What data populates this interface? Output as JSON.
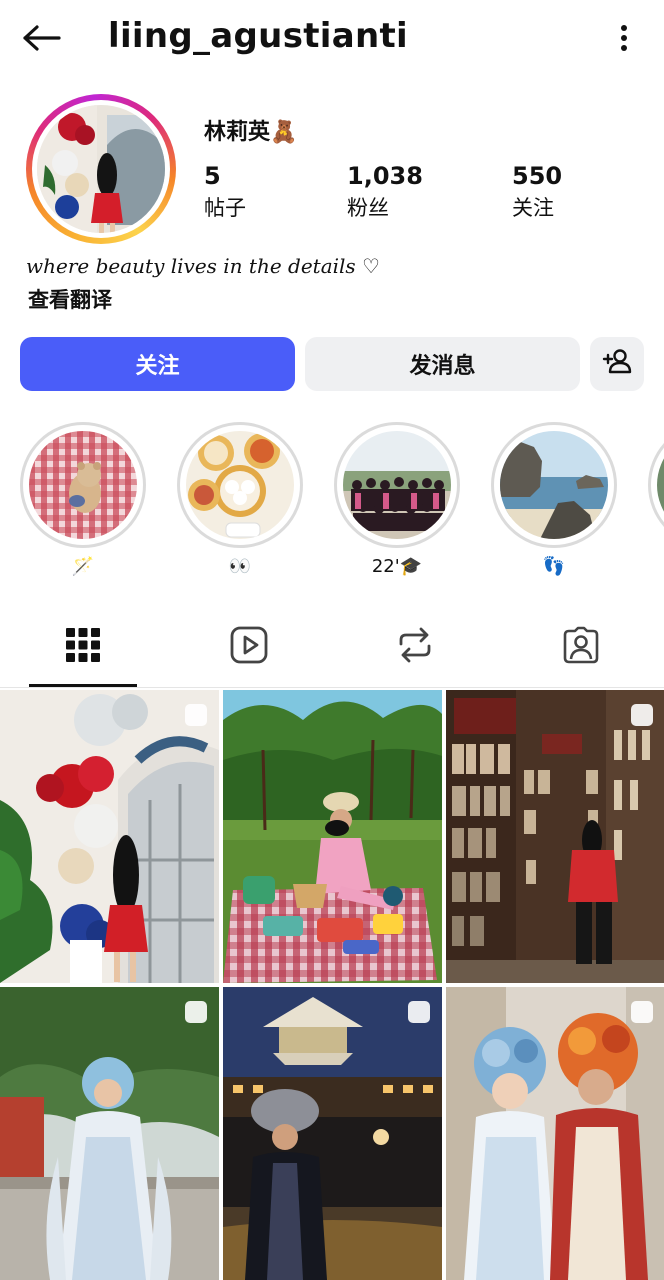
{
  "header": {
    "back_icon": "arrow-left-icon",
    "username": "liing_agustianti",
    "menu_icon": "vertical-dots-icon"
  },
  "profile": {
    "full_name": "林莉英🧸",
    "stats": [
      {
        "value": "5",
        "label": "帖子"
      },
      {
        "value": "1,038",
        "label": "粉丝"
      },
      {
        "value": "550",
        "label": "关注"
      }
    ],
    "bio": "where beauty lives in the details ♡",
    "translate_link": "查看翻译",
    "story_ring_colors": [
      "#f9b233",
      "#dd2a7b",
      "#c026d3"
    ]
  },
  "actions": {
    "follow_label": "关注",
    "message_label": "发消息",
    "add_user_icon": "add-person-icon",
    "follow_color": "#4a5df9"
  },
  "highlights": [
    {
      "label": "🪄",
      "content": "picnic-teddy-bear"
    },
    {
      "label": "👀",
      "content": "dim-sum"
    },
    {
      "label": "22'🎓",
      "content": "graduation-group"
    },
    {
      "label": "👣",
      "content": "coastal-rocks"
    }
  ],
  "tabs": [
    {
      "name": "posts",
      "icon": "grid-icon",
      "active": true
    },
    {
      "name": "reels",
      "icon": "reels-play-icon",
      "active": false
    },
    {
      "name": "reposts",
      "icon": "repost-icon",
      "active": false
    },
    {
      "name": "tagged",
      "icon": "tagged-person-icon",
      "active": false
    }
  ],
  "posts": [
    {
      "content": "girl-in-red-dress-flower-arch",
      "multi": true
    },
    {
      "content": "picnic-on-grass",
      "multi": false
    },
    {
      "content": "bookstore-shelves",
      "multi": true
    },
    {
      "content": "girl-in-hanfu-headdress",
      "multi": true
    },
    {
      "content": "night-pavilion-traditional-costume",
      "multi": true
    },
    {
      "content": "two-girls-floral-headdresses",
      "multi": true
    }
  ]
}
